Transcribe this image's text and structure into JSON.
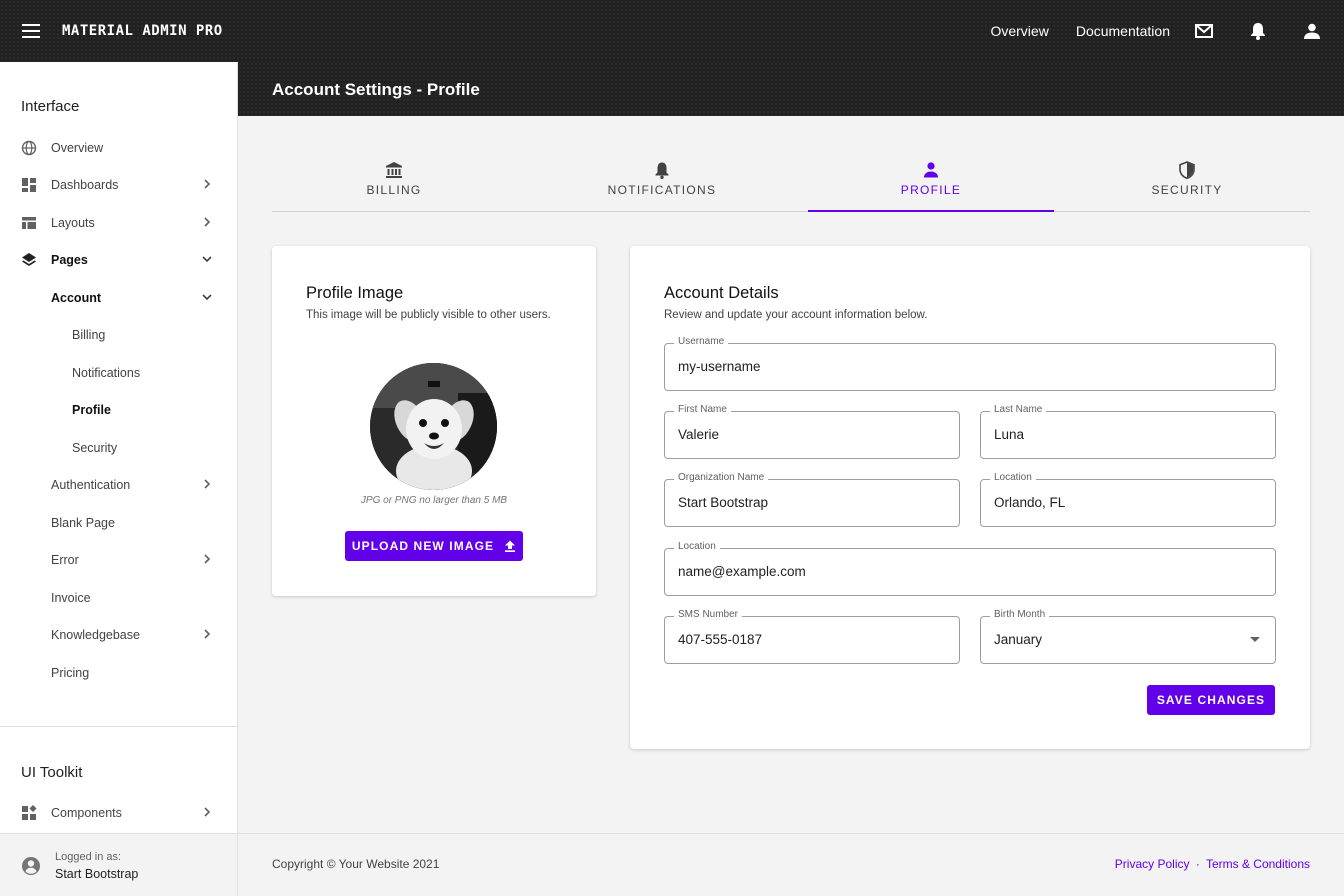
{
  "topbar": {
    "brand": "MATERIAL ADMIN PRO",
    "links": [
      "Overview",
      "Documentation"
    ],
    "icons": [
      "mail-icon",
      "bell-icon",
      "account-icon"
    ]
  },
  "sidebar": {
    "heading_interface": "Interface",
    "items": {
      "overview": "Overview",
      "dashboards": "Dashboards",
      "layouts": "Layouts",
      "pages": "Pages",
      "account": "Account",
      "billing": "Billing",
      "notifications": "Notifications",
      "profile": "Profile",
      "security": "Security",
      "authentication": "Authentication",
      "blank_page": "Blank Page",
      "error": "Error",
      "invoice": "Invoice",
      "knowledgebase": "Knowledgebase",
      "pricing": "Pricing",
      "components": "Components"
    },
    "heading_toolkit": "UI Toolkit",
    "footer": {
      "sub": "Logged in as:",
      "name": "Start Bootstrap"
    }
  },
  "page": {
    "title": "Account Settings - Profile"
  },
  "tabs": [
    {
      "label": "BILLING",
      "icon": "bank-icon"
    },
    {
      "label": "NOTIFICATIONS",
      "icon": "bell-icon"
    },
    {
      "label": "PROFILE",
      "icon": "person-icon",
      "active": true
    },
    {
      "label": "SECURITY",
      "icon": "shield-icon"
    }
  ],
  "profile_card": {
    "title": "Profile Image",
    "subtitle": "This image will be publicly visible to other users.",
    "note": "JPG or PNG no larger than 5 MB",
    "upload_label": "UPLOAD NEW IMAGE"
  },
  "account_card": {
    "title": "Account Details",
    "subtitle": "Review and update your account information below.",
    "fields": {
      "username": {
        "label": "Username",
        "value": "my-username"
      },
      "first_name": {
        "label": "First Name",
        "value": "Valerie"
      },
      "last_name": {
        "label": "Last Name",
        "value": "Luna"
      },
      "org": {
        "label": "Organization Name",
        "value": "Start Bootstrap"
      },
      "location": {
        "label": "Location",
        "value": "Orlando, FL"
      },
      "email": {
        "label": "Location",
        "value": "name@example.com"
      },
      "sms": {
        "label": "SMS Number",
        "value": "407-555-0187"
      },
      "birth_month": {
        "label": "Birth Month",
        "value": "January"
      }
    },
    "save_label": "SAVE CHANGES"
  },
  "footer": {
    "copyright": "Copyright © Your Website 2021",
    "privacy": "Privacy Policy",
    "separator": "·",
    "terms": "Terms & Conditions"
  },
  "colors": {
    "accent": "#6200ea",
    "topbar": "#212121",
    "background": "#f3f3f3"
  }
}
